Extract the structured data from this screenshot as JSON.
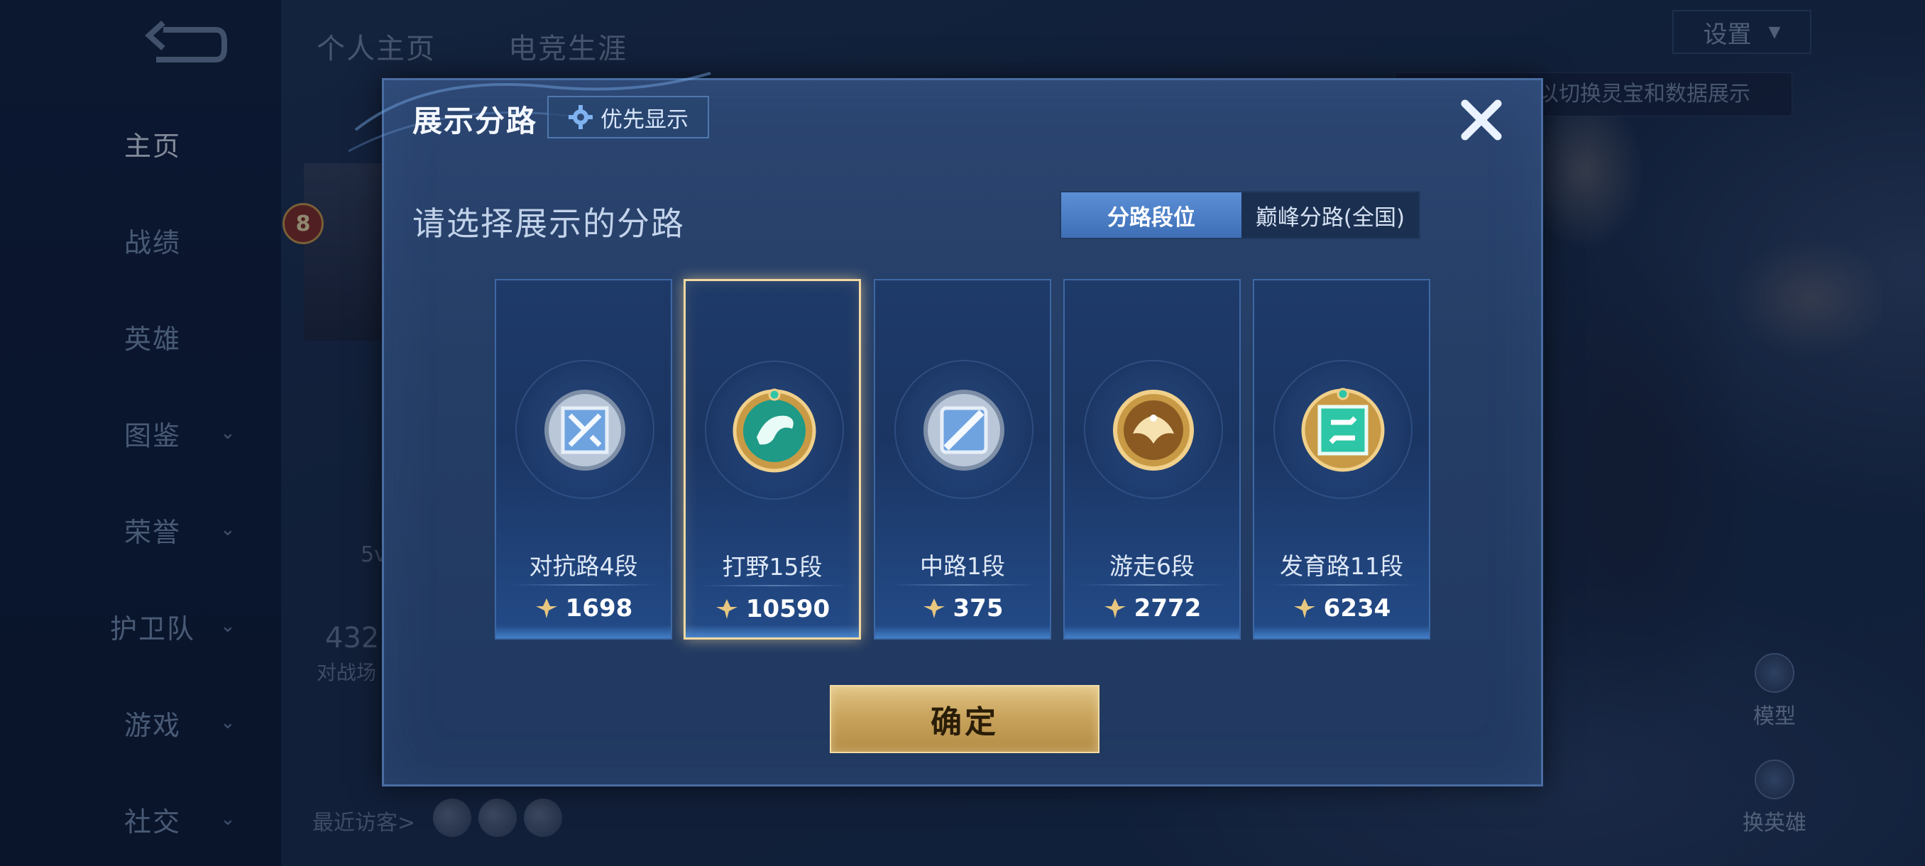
{
  "background": {
    "nav": {
      "items": [
        {
          "label": "主页",
          "active": true,
          "chevron": false
        },
        {
          "label": "战绩",
          "active": false,
          "chevron": false
        },
        {
          "label": "英雄",
          "active": false,
          "chevron": false
        },
        {
          "label": "图鉴",
          "active": false,
          "chevron": true
        },
        {
          "label": "荣誉",
          "active": false,
          "chevron": true
        },
        {
          "label": "护卫队",
          "active": false,
          "chevron": true
        },
        {
          "label": "游戏",
          "active": false,
          "chevron": true
        },
        {
          "label": "社交",
          "active": false,
          "chevron": true
        }
      ]
    },
    "top_tabs": [
      "个人主页",
      "电竞生涯"
    ],
    "settings_label": "设置",
    "hint_text": "以切换灵宝和数据展示",
    "level_badge": "8",
    "partial_stats": [
      "5v",
      "432",
      "对战场"
    ],
    "recent_visitors_label": "最近访客>",
    "right_icons": [
      "模型",
      "换英雄"
    ]
  },
  "modal": {
    "title": "展示分路",
    "priority_label": "优先显示",
    "subtitle": "请选择展示的分路",
    "segments": [
      {
        "label": "分路段位",
        "active": true
      },
      {
        "label": "巅峰分路(全国)",
        "active": false
      }
    ],
    "lanes": [
      {
        "name": "对抗路4段",
        "score": "1698",
        "icon": "clash-lane-silver-emblem",
        "selected": false
      },
      {
        "name": "打野15段",
        "score": "10590",
        "icon": "jungle-dragon-gold-emblem",
        "selected": true
      },
      {
        "name": "中路1段",
        "score": "375",
        "icon": "mid-lane-silver-emblem",
        "selected": false
      },
      {
        "name": "游走6段",
        "score": "2772",
        "icon": "roam-wings-gold-emblem",
        "selected": false
      },
      {
        "name": "发育路11段",
        "score": "6234",
        "icon": "farm-lane-gold-emblem",
        "selected": false
      }
    ],
    "confirm_label": "确定"
  },
  "colors": {
    "accent_blue": "#4a6da2",
    "selected_border": "#f3d9a2",
    "confirm_gold": "#c9a45d"
  }
}
